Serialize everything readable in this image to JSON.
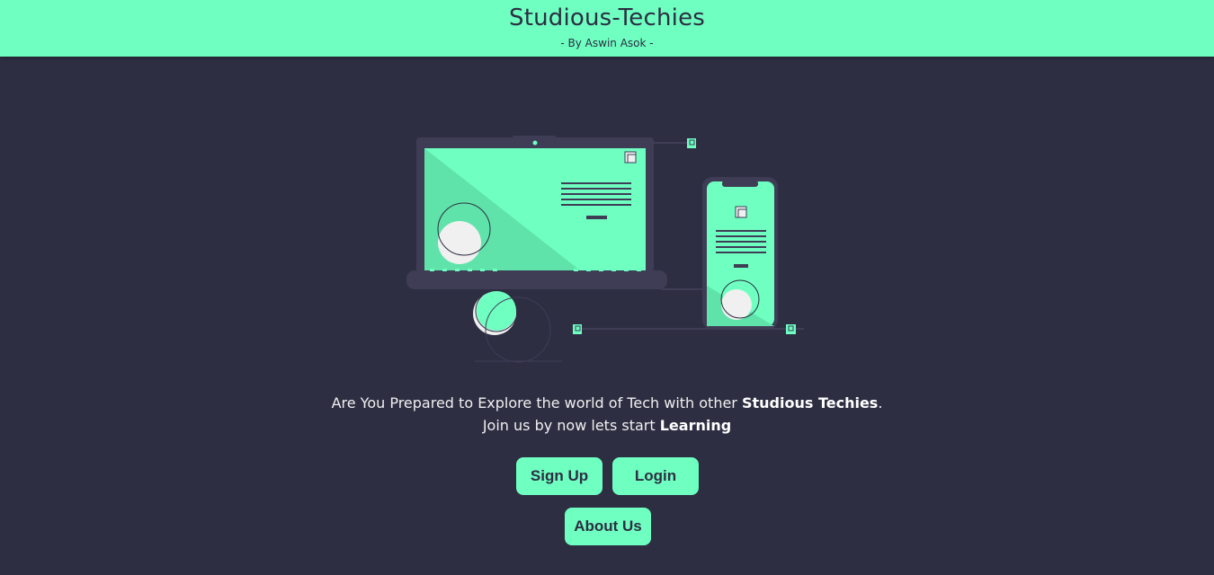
{
  "header": {
    "title": "Studious-Techies",
    "subtitle": "- By Aswin Asok -"
  },
  "hero": {
    "illustration": "laptop-and-phone-illustration-icon"
  },
  "tagline": {
    "line1_prefix": "Are You Prepared to Explore the world of Tech with other ",
    "line1_bold": "Studious Techies",
    "line1_suffix": ".",
    "line2_prefix": "Join us by now lets start ",
    "line2_bold": "Learning"
  },
  "buttons": {
    "signup": "Sign Up",
    "login": "Login",
    "about": "About Us"
  },
  "colors": {
    "accent": "#6effc1",
    "background": "#2d2e42",
    "device": "#3f3d56"
  }
}
